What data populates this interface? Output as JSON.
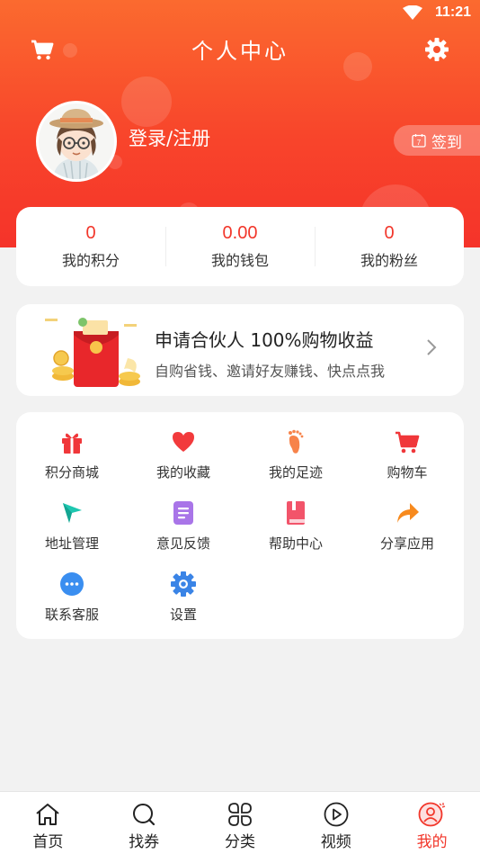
{
  "status": {
    "time": "11:21"
  },
  "header": {
    "title": "个人中心",
    "login_label": "登录/注册",
    "signin_label": "签到",
    "signin_day": "7"
  },
  "stats": [
    {
      "value": "0",
      "label": "我的积分"
    },
    {
      "value": "0.00",
      "label": "我的钱包"
    },
    {
      "value": "0",
      "label": "我的粉丝"
    }
  ],
  "partner": {
    "title": "申请合伙人 100%购物收益",
    "subtitle": "自购省钱、邀请好友赚钱、快点点我"
  },
  "menu": [
    {
      "label": "积分商城",
      "icon": "gift-icon"
    },
    {
      "label": "我的收藏",
      "icon": "heart-icon"
    },
    {
      "label": "我的足迹",
      "icon": "footprint-icon"
    },
    {
      "label": "购物车",
      "icon": "cart-icon"
    },
    {
      "label": "地址管理",
      "icon": "location-icon"
    },
    {
      "label": "意见反馈",
      "icon": "feedback-icon"
    },
    {
      "label": "帮助中心",
      "icon": "book-icon"
    },
    {
      "label": "分享应用",
      "icon": "share-icon"
    },
    {
      "label": "联系客服",
      "icon": "chat-icon"
    },
    {
      "label": "设置",
      "icon": "gear-icon"
    }
  ],
  "tabs": [
    {
      "label": "首页",
      "icon": "home-icon"
    },
    {
      "label": "找券",
      "icon": "search-icon"
    },
    {
      "label": "分类",
      "icon": "category-icon"
    },
    {
      "label": "视频",
      "icon": "play-icon"
    },
    {
      "label": "我的",
      "icon": "user-icon",
      "active": true
    }
  ],
  "colors": {
    "accent": "#f2362a",
    "header_top": "#fb6a2f",
    "header_bottom": "#f5332a"
  }
}
